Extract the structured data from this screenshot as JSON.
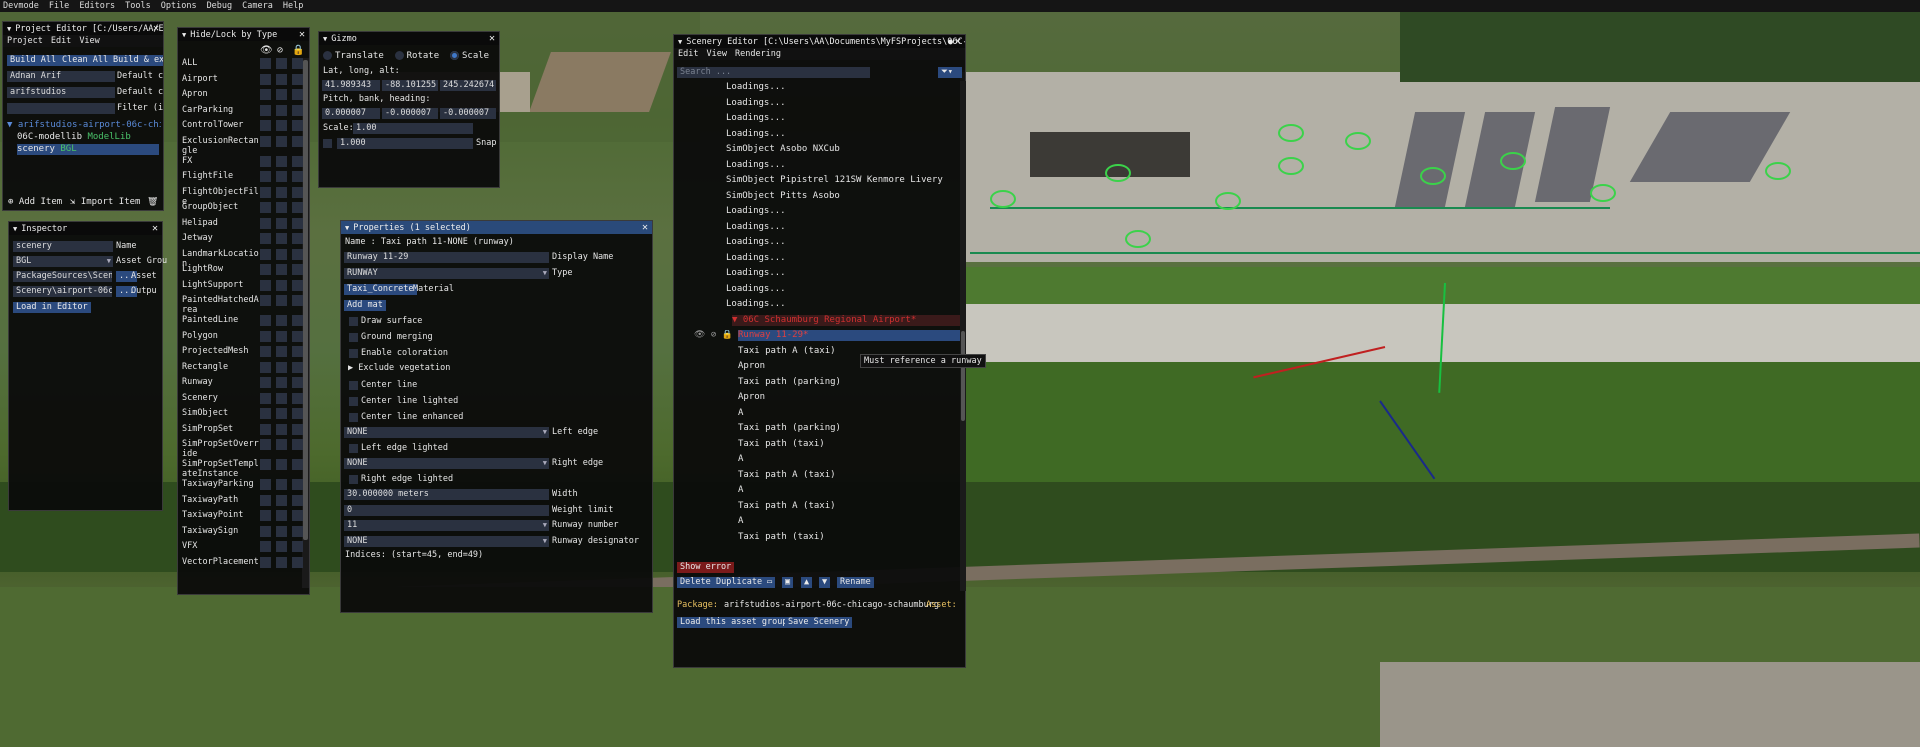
{
  "menubar": [
    "Devmode",
    "File",
    "Editors",
    "Tools",
    "Options",
    "Debug",
    "Camera",
    "Help"
  ],
  "project_editor": {
    "title": "Project Editor [C:/Users/AA/E",
    "menus": [
      "Project",
      "Edit",
      "View"
    ],
    "buttons": [
      "Build All",
      "Clean All",
      "Build & ex"
    ],
    "fields": [
      {
        "value": "Adnan Arif",
        "label": "Default c"
      },
      {
        "value": "arifstudios",
        "label": "Default c"
      },
      {
        "value": "",
        "label": "Filter (i"
      }
    ],
    "tree_root": "arifstudios-airport-06c-chic",
    "tree_items": [
      {
        "name": "06C-modellib",
        "tag": "ModelLib"
      },
      {
        "name": "scenery",
        "tag": "BGL"
      }
    ],
    "add_item": "Add Item",
    "import_item": "Import Item"
  },
  "inspector": {
    "title": "Inspector",
    "rows": [
      {
        "value": "scenery",
        "label": "Name"
      },
      {
        "value": "BGL",
        "label": "Asset Grou"
      },
      {
        "value": "PackageSources\\Scener",
        "label": "Asset"
      },
      {
        "value": "Scenery\\airport-06c-c",
        "label": "Outpu"
      }
    ],
    "load_button": "Load in Editor"
  },
  "hide_lock": {
    "title": "Hide/Lock by Type",
    "types": [
      "ALL",
      "Airport",
      "Apron",
      "CarParking",
      "ControlTower",
      "ExclusionRectangle",
      "FX",
      "FlightFile",
      "FlightObjectFile",
      "GroupObject",
      "Helipad",
      "Jetway",
      "LandmarkLocation",
      "LightRow",
      "LightSupport",
      "PaintedHatchedArea",
      "PaintedLine",
      "Polygon",
      "ProjectedMesh",
      "Rectangle",
      "Runway",
      "Scenery",
      "SimObject",
      "SimPropSet",
      "SimPropSetOverride",
      "SimPropSetTemplateInstance",
      "TaxiwayParking",
      "TaxiwayPath",
      "TaxiwayPoint",
      "TaxiwaySign",
      "VFX",
      "VectorPlacement"
    ]
  },
  "gizmo": {
    "title": "Gizmo",
    "modes": [
      {
        "label": "Translate",
        "on": false
      },
      {
        "label": "Rotate",
        "on": false
      },
      {
        "label": "Scale",
        "on": true
      }
    ],
    "latlonalt_label": "Lat, long, alt:",
    "latlonalt": [
      "41.989343",
      "-88.101255",
      "245.242674"
    ],
    "pbh_label": "Pitch, bank, heading:",
    "pbh": [
      "0.000007",
      "-0.000007",
      "-0.000007"
    ],
    "scale_label": "Scale:",
    "scale": "1.00",
    "snap_value": "1.000",
    "snap_label": "Snap"
  },
  "properties": {
    "title": "Properties (1 selected)",
    "name_line": "Name : Taxi path 11-NONE (runway)",
    "display_name": {
      "value": "Runway 11-29",
      "label": "Display Name"
    },
    "type": {
      "value": "RUNWAY",
      "label": "Type"
    },
    "material": {
      "value": "Taxi_Concrete",
      "label": "Material"
    },
    "add_mat": "Add mat",
    "checks": [
      "Draw surface",
      "Ground merging",
      "Enable coloration"
    ],
    "exclude_veg": "Exclude vegetation",
    "center_checks": [
      "Center line",
      "Center line lighted",
      "Center line enhanced"
    ],
    "left_edge": {
      "value": "NONE",
      "label": "Left edge"
    },
    "left_lighted": "Left edge lighted",
    "right_edge": {
      "value": "NONE",
      "label": "Right edge"
    },
    "right_lighted": "Right edge lighted",
    "width": {
      "value": "30.000000 meters",
      "label": "Width"
    },
    "weight": {
      "value": "0",
      "label": "Weight limit"
    },
    "rwy_number": {
      "value": "11",
      "label": "Runway number"
    },
    "rwy_designator": {
      "value": "NONE",
      "label": "Runway designator"
    },
    "indices": "Indices: (start=45, end=49)"
  },
  "scenery_editor": {
    "title": "Scenery Editor [C:\\Users\\AA\\Documents\\MyFSProjects\\06C-",
    "menus": [
      "Edit",
      "View",
      "Rendering"
    ],
    "search_placeholder": "Search ...",
    "items": [
      "Loadings...",
      "Loadings...",
      "Loadings...",
      "Loadings...",
      "SimObject Asobo NXCub",
      "Loadings...",
      "SimObject Pipistrel 121SW Kenmore Livery",
      "SimObject Pitts Asobo",
      "Loadings...",
      "Loadings...",
      "Loadings...",
      "Loadings...",
      "Loadings...",
      "Loadings...",
      "Loadings..."
    ],
    "airport": "06C Schaumburg Regional Airport*",
    "selected": "Runway 11-29*",
    "children": [
      "Taxi path A (taxi)",
      "Apron",
      "Taxi path  (parking)",
      "Apron",
      "A",
      "Taxi path  (parking)",
      "Taxi path  (taxi)",
      "A",
      "Taxi path A (taxi)",
      "A",
      "Taxi path A (taxi)",
      "A",
      "Taxi path  (taxi)"
    ],
    "tooltip": "Must reference a runway",
    "show_error": "Show error",
    "actions": [
      "Delete",
      "Duplicate"
    ],
    "rename": "Rename",
    "package_label": "Package:",
    "package_value": "arifstudios-airport-06c-chicago-schaumburg",
    "asset_label": "Asset:",
    "load_group": "Load this asset group",
    "save_scenery": "Save Scenery"
  },
  "colors": {
    "accent": "#2b4a7e",
    "error": "#cc2020",
    "window_bg": "#0b0b0b",
    "field": "#2a3140"
  }
}
